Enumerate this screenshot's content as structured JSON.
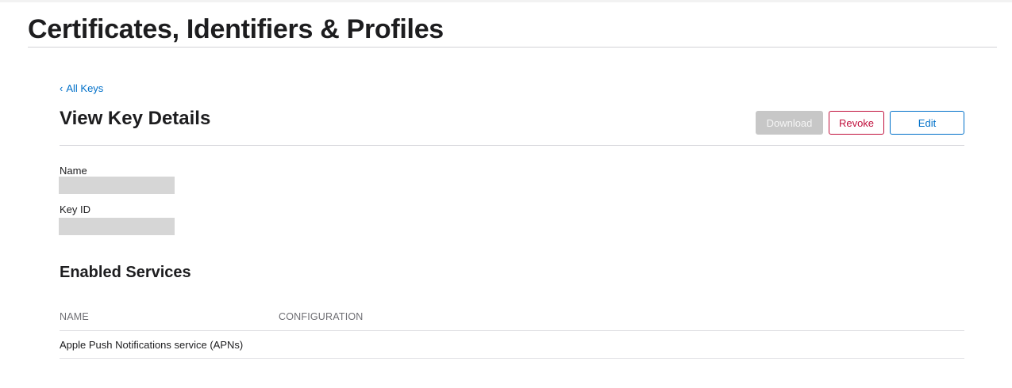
{
  "header": {
    "title": "Certificates, Identifiers & Profiles"
  },
  "nav": {
    "back_label": "All Keys",
    "back_chevron": "‹"
  },
  "details": {
    "title": "View Key Details",
    "buttons": {
      "download": "Download",
      "revoke": "Revoke",
      "edit": "Edit"
    },
    "fields": {
      "name_label": "Name",
      "name_value": "",
      "key_id_label": "Key ID",
      "key_id_value": ""
    }
  },
  "services": {
    "title": "Enabled Services",
    "columns": [
      "NAME",
      "CONFIGURATION"
    ],
    "rows": [
      {
        "name": "Apple Push Notifications service (APNs)",
        "configuration": ""
      }
    ]
  },
  "colors": {
    "link": "#0070c9",
    "revoke": "#c0103c",
    "disabled": "#c7c7c7",
    "redaction": "#d6d6d6"
  }
}
